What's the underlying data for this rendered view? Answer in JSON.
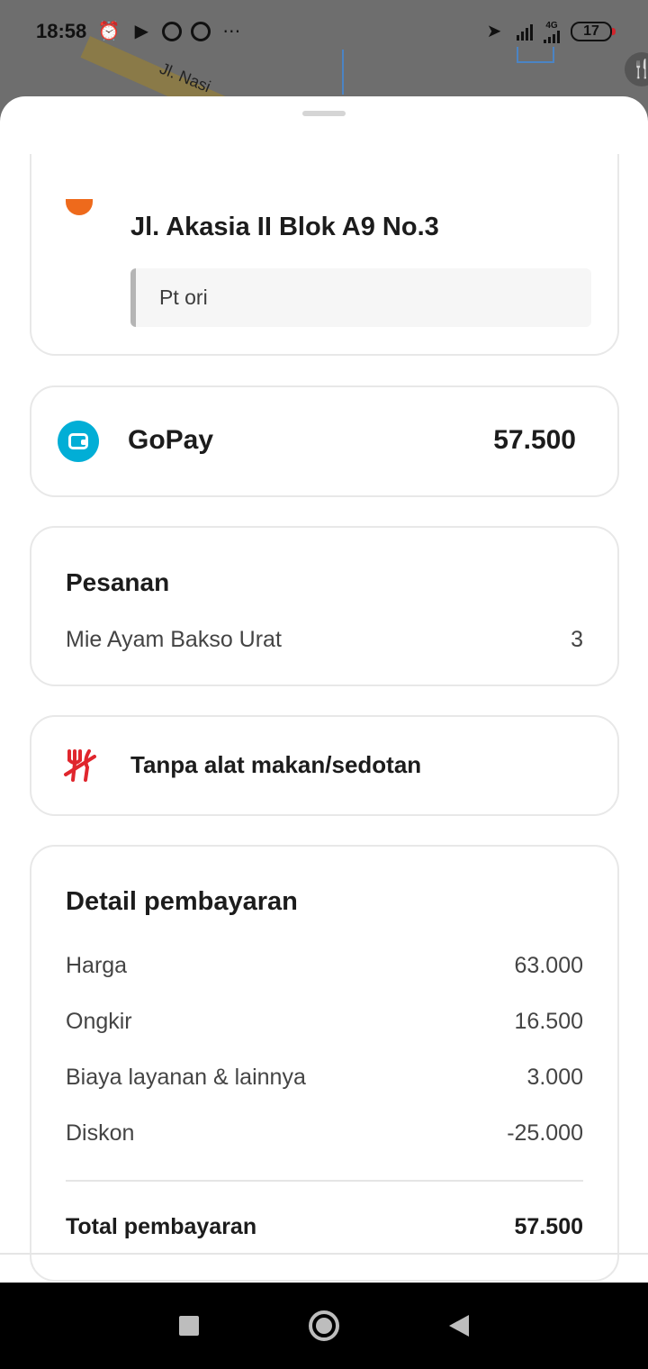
{
  "status_bar": {
    "time": "18:58",
    "overflow": "⋯",
    "network": "4G",
    "battery": "17"
  },
  "map": {
    "street_label": "Jl. Nasi"
  },
  "address": {
    "title": "Jl. Akasia II Blok A9 No.3",
    "note": "Pt ori"
  },
  "payment_method": {
    "label": "GoPay",
    "amount": "57.500"
  },
  "order": {
    "title": "Pesanan",
    "items": [
      {
        "name": "Mie Ayam Bakso Urat",
        "qty": "3"
      }
    ]
  },
  "cutlery": {
    "label": "Tanpa alat makan/sedotan"
  },
  "payment_detail": {
    "title": "Detail pembayaran",
    "rows": [
      {
        "label": "Harga",
        "value": "63.000"
      },
      {
        "label": "Ongkir",
        "value": "16.500"
      },
      {
        "label": "Biaya layanan & lainnya",
        "value": "3.000"
      },
      {
        "label": "Diskon",
        "value": "-25.000"
      }
    ],
    "total_label": "Total pembayaran",
    "total_value": "57.500"
  },
  "colors": {
    "gopay": "#01aed6",
    "cutlery_icon": "#e0262d",
    "address_marker": "#ee6a1c"
  },
  "icons": {
    "status": [
      "alarm-icon",
      "play-store-icon",
      "app-icon",
      "app-icon"
    ],
    "nav": [
      "recent-apps-icon",
      "home-icon",
      "back-icon"
    ]
  }
}
